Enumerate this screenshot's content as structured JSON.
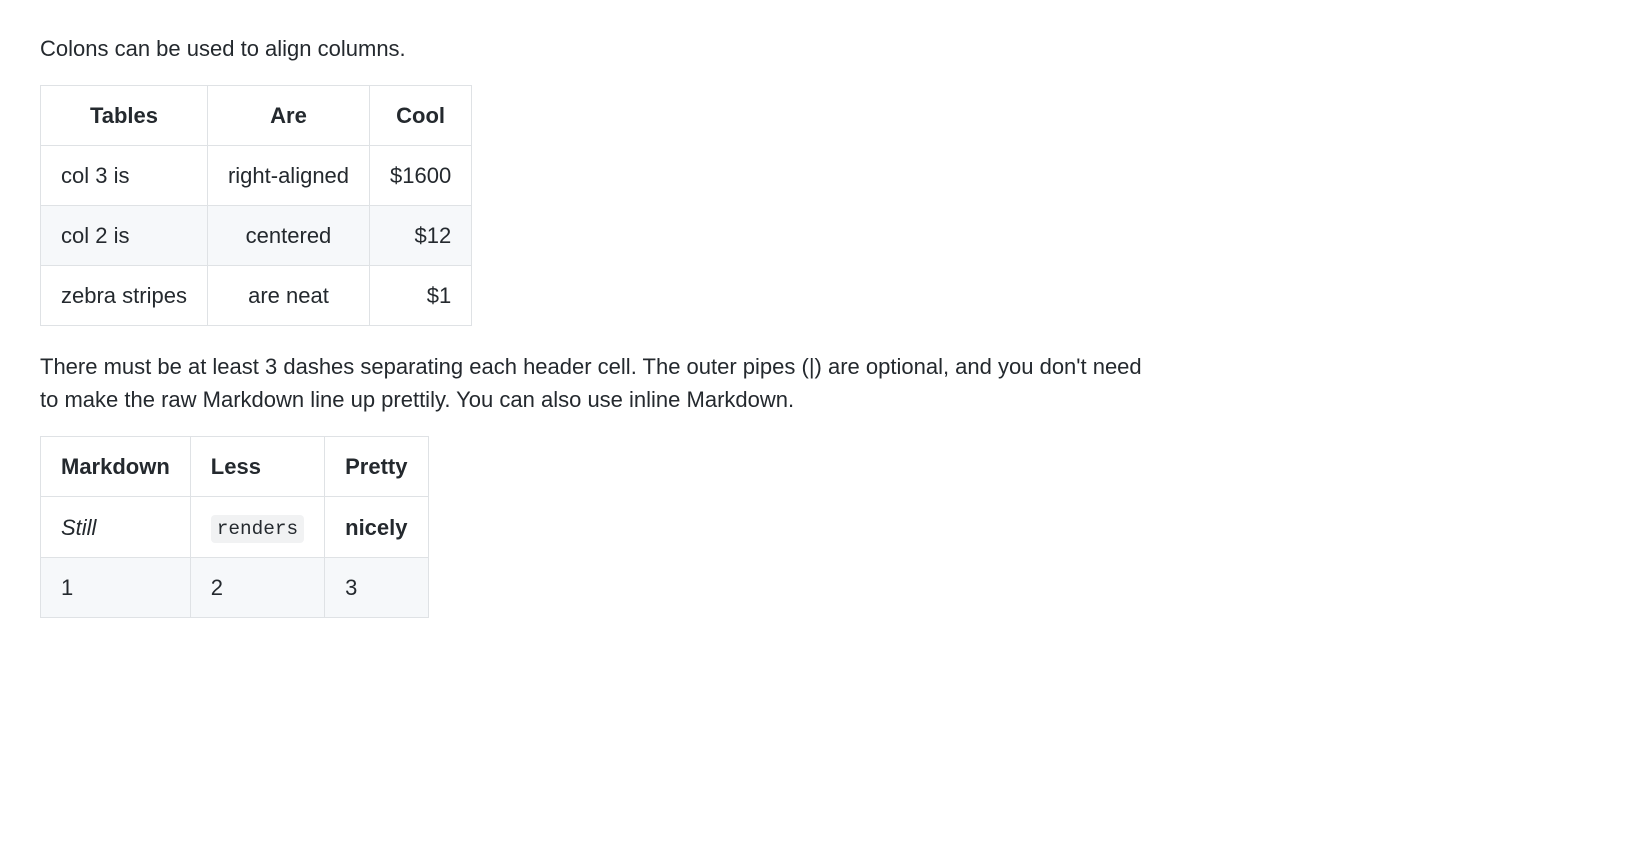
{
  "intro_text": "Colons can be used to align columns.",
  "table1": {
    "headers": [
      "Tables",
      "Are",
      "Cool"
    ],
    "align": [
      "center",
      "center",
      "center"
    ],
    "body_align": [
      "left",
      "center",
      "right"
    ],
    "rows": [
      [
        "col 3 is",
        "right-aligned",
        "$1600"
      ],
      [
        "col 2 is",
        "centered",
        "$12"
      ],
      [
        "zebra stripes",
        "are neat",
        "$1"
      ]
    ]
  },
  "mid_text": "There must be at least 3 dashes separating each header cell. The outer pipes (|) are optional, and you don't need to make the raw Markdown line up prettily. You can also use inline Markdown.",
  "table2": {
    "headers": [
      "Markdown",
      "Less",
      "Pretty"
    ],
    "rows": [
      {
        "cells": [
          {
            "text": "Still",
            "style": "italic"
          },
          {
            "text": "renders",
            "style": "code"
          },
          {
            "text": "nicely",
            "style": "bold"
          }
        ]
      },
      {
        "cells": [
          {
            "text": "1",
            "style": "plain"
          },
          {
            "text": "2",
            "style": "plain"
          },
          {
            "text": "3",
            "style": "plain"
          }
        ]
      }
    ]
  }
}
